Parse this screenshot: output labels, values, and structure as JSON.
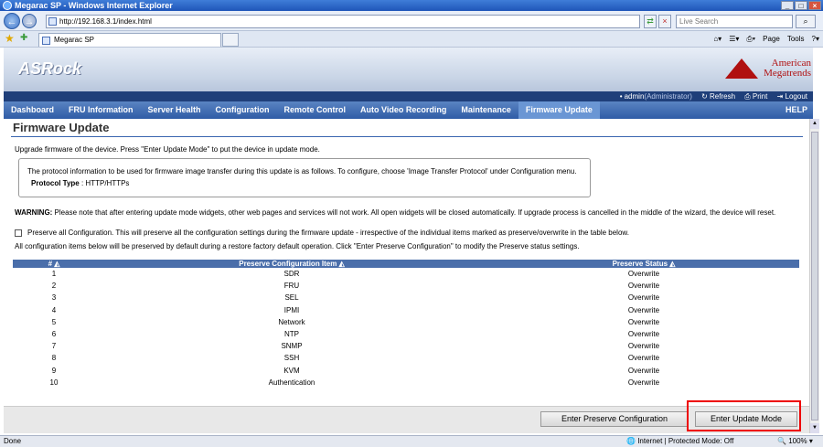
{
  "window": {
    "title": "Megarac SP - Windows Internet Explorer"
  },
  "address": {
    "url": "http://192.168.3.1/index.html",
    "search_placeholder": "Live Search"
  },
  "tab": {
    "label": "Megarac SP"
  },
  "commands": {
    "page": "Page",
    "tools": "Tools"
  },
  "brand": {
    "logo": "ASRock",
    "ami_line1": "American",
    "ami_line2": "Megatrends"
  },
  "userbar": {
    "user": "admin",
    "role": "(Administrator)",
    "refresh": "Refresh",
    "print": "Print",
    "logout": "Logout"
  },
  "nav": {
    "items": [
      "Dashboard",
      "FRU Information",
      "Server Health",
      "Configuration",
      "Remote Control",
      "Auto Video Recording",
      "Maintenance",
      "Firmware Update"
    ],
    "help": "HELP"
  },
  "page": {
    "title": "Firmware Update",
    "intro": "Upgrade firmware of the device. Press \"Enter Update Mode\" to put the device in update mode.",
    "protocol_info": "The protocol information to be used for firmware image transfer during this update is as follows. To configure, choose 'Image Transfer Protocol' under Configuration menu.",
    "protocol_label": "Protocol Type",
    "protocol_value": ": HTTP/HTTPs",
    "warning_label": "WARNING:",
    "warning_text": " Please note that after entering update mode widgets, other web pages and services will not work. All open widgets will be closed automatically. If upgrade process is cancelled in the middle of the wizard, the device will reset.",
    "preserve_all": "Preserve all Configuration. This will preserve all the configuration settings during the firmware update - irrespective of the individual items marked as preserve/overwrite in the table below.",
    "preserve_note": "All configuration items below will be preserved by default during a restore factory default operation. Click \"Enter Preserve Configuration\" to modify the Preserve status settings."
  },
  "table": {
    "headers": [
      "#",
      "Preserve Configuration Item",
      "Preserve Status"
    ],
    "rows": [
      [
        "1",
        "SDR",
        "Overwrite"
      ],
      [
        "2",
        "FRU",
        "Overwrite"
      ],
      [
        "3",
        "SEL",
        "Overwrite"
      ],
      [
        "4",
        "IPMI",
        "Overwrite"
      ],
      [
        "5",
        "Network",
        "Overwrite"
      ],
      [
        "6",
        "NTP",
        "Overwrite"
      ],
      [
        "7",
        "SNMP",
        "Overwrite"
      ],
      [
        "8",
        "SSH",
        "Overwrite"
      ],
      [
        "9",
        "KVM",
        "Overwrite"
      ],
      [
        "10",
        "Authentication",
        "Overwrite"
      ]
    ]
  },
  "buttons": {
    "preserve": "Enter Preserve Configuration",
    "update": "Enter Update Mode"
  },
  "status": {
    "left": "Done",
    "zone": "Internet | Protected Mode: Off",
    "zoom": "100%"
  }
}
